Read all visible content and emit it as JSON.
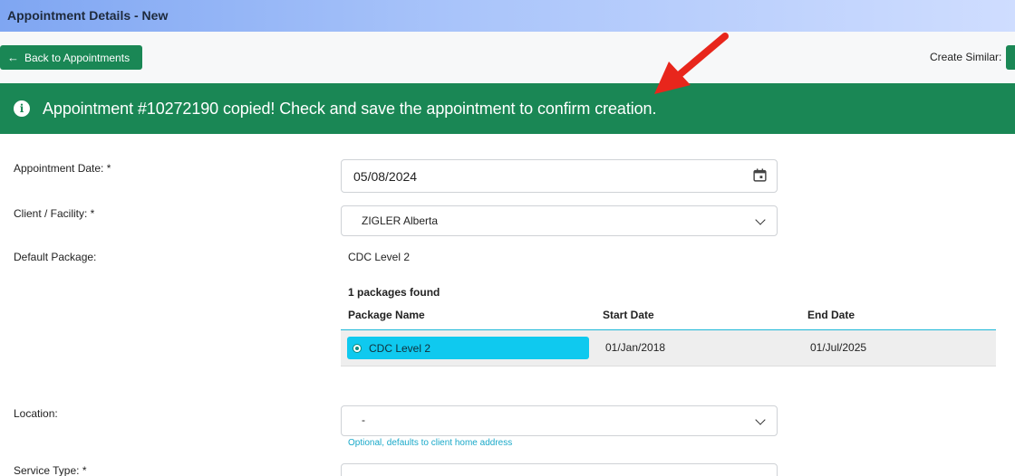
{
  "window": {
    "title": "Appointment Details - New"
  },
  "toolbar": {
    "back_label": "Back to Appointments",
    "back_icon": "arrow-left-icon",
    "create_similar_label": "Create Similar:"
  },
  "alert": {
    "icon": "info-icon",
    "message": "Appointment #10272190 copied! Check and save the appointment to confirm creation."
  },
  "form": {
    "appointment_date": {
      "label": "Appointment Date: *",
      "value": "05/08/2024",
      "icon": "calendar-icon"
    },
    "client_facility": {
      "label": "Client / Facility: *",
      "value": "ZIGLER Alberta"
    },
    "default_package": {
      "label": "Default Package:",
      "value": "CDC Level 2"
    },
    "packages": {
      "found_text": "1 packages found",
      "columns": [
        "Package Name",
        "Start Date",
        "End Date"
      ],
      "rows": [
        {
          "name": "CDC Level 2",
          "start": "01/Jan/2018",
          "end": "01/Jul/2025",
          "selected": true
        }
      ]
    },
    "location": {
      "label": "Location:",
      "value": "-",
      "hint": "Optional, defaults to client home address"
    },
    "service_type": {
      "label": "Service Type: *"
    }
  },
  "colors": {
    "primary_green": "#1a8755",
    "selected_cyan": "#0fc9ef",
    "hint_blue": "#1aa9c9",
    "annotation_red": "#e8261c"
  }
}
